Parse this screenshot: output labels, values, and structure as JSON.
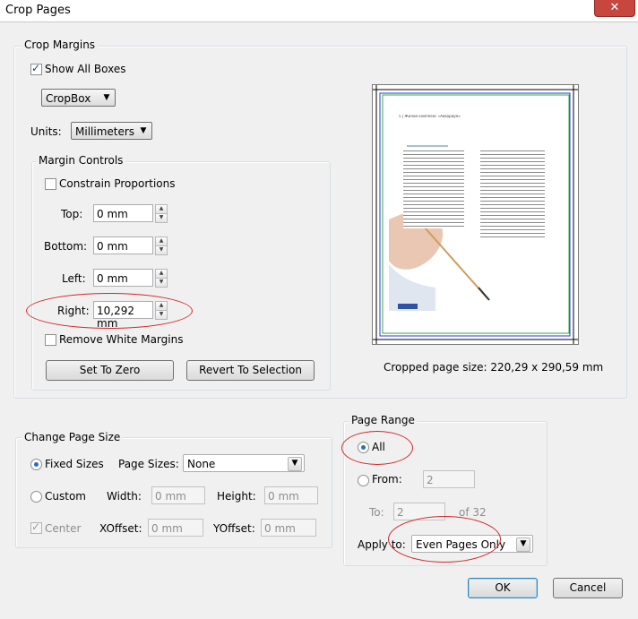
{
  "window": {
    "title": "Crop Pages",
    "close_label": "✕"
  },
  "crop_margins": {
    "legend": "Crop Margins",
    "show_all_boxes": {
      "label": "Show All Boxes",
      "checked": true
    },
    "box_select": {
      "value": "CropBox"
    },
    "units": {
      "label": "Units:",
      "value": "Millimeters"
    },
    "margin_controls": {
      "legend": "Margin Controls",
      "constrain": {
        "label": "Constrain Proportions",
        "checked": false
      },
      "top": {
        "label": "Top:",
        "value": "0 mm"
      },
      "bottom": {
        "label": "Bottom:",
        "value": "0 mm"
      },
      "left": {
        "label": "Left:",
        "value": "0 mm"
      },
      "right": {
        "label": "Right:",
        "value": "10,292 mm"
      },
      "remove_white": {
        "label": "Remove White Margins",
        "checked": false
      },
      "set_to_zero": "Set To Zero",
      "revert": "Revert To Selection"
    }
  },
  "preview": {
    "header": "5  |  Жилой комплекс «Аквариум»",
    "cropped_size": "Cropped page size: 220,29 x 290,59 mm"
  },
  "change_page_size": {
    "legend": "Change Page Size",
    "fixed_sizes": {
      "label": "Fixed Sizes",
      "checked": true
    },
    "page_sizes_label": "Page Sizes:",
    "page_sizes_value": "None",
    "custom": {
      "label": "Custom",
      "checked": false
    },
    "width": {
      "label": "Width:",
      "value": "0 mm"
    },
    "height": {
      "label": "Height:",
      "value": "0 mm"
    },
    "center": {
      "label": "Center",
      "checked": true
    },
    "xoffset": {
      "label": "XOffset:",
      "value": "0 mm"
    },
    "yoffset": {
      "label": "YOffset:",
      "value": "0 mm"
    }
  },
  "page_range": {
    "legend": "Page Range",
    "all": {
      "label": "All",
      "checked": true
    },
    "from": {
      "label": "From:",
      "value": "2"
    },
    "to": {
      "label": "To:",
      "value": "2"
    },
    "of": "of 32",
    "apply_to": {
      "label": "Apply to:",
      "value": "Even Pages Only"
    }
  },
  "buttons": {
    "ok": "OK",
    "cancel": "Cancel"
  },
  "colors": {
    "accent": "#3c7fb1",
    "annotation": "#d4262a",
    "crop_green": "#2fae4a",
    "crop_blue": "#2b3ad6"
  }
}
